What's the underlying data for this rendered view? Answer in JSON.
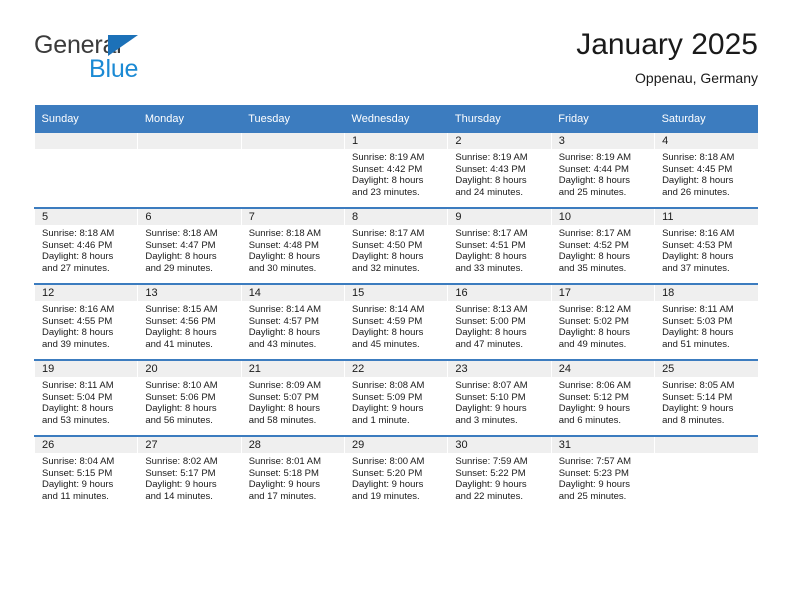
{
  "brand": {
    "name_line1": "General",
    "name_line2": "Blue",
    "triangle_color": "#1c71b8",
    "line1_color": "#3b3b3b",
    "line2_color": "#1b8ad4"
  },
  "header": {
    "title": "January 2025",
    "subtitle": "Oppenau, Germany"
  },
  "theme": {
    "header_bg": "#3c7cbf",
    "header_text": "#ffffff",
    "date_band_bg": "#efefef",
    "cell_bg": "#ffffff",
    "text": "#1a1a1a"
  },
  "calendar": {
    "weekday_headers": [
      "Sunday",
      "Monday",
      "Tuesday",
      "Wednesday",
      "Thursday",
      "Friday",
      "Saturday"
    ],
    "weeks": [
      [
        {
          "day": "",
          "empty": true
        },
        {
          "day": "",
          "empty": true
        },
        {
          "day": "",
          "empty": true
        },
        {
          "day": "1",
          "sunrise": "Sunrise: 8:19 AM",
          "sunset": "Sunset: 4:42 PM",
          "daylight1": "Daylight: 8 hours",
          "daylight2": "and 23 minutes."
        },
        {
          "day": "2",
          "sunrise": "Sunrise: 8:19 AM",
          "sunset": "Sunset: 4:43 PM",
          "daylight1": "Daylight: 8 hours",
          "daylight2": "and 24 minutes."
        },
        {
          "day": "3",
          "sunrise": "Sunrise: 8:19 AM",
          "sunset": "Sunset: 4:44 PM",
          "daylight1": "Daylight: 8 hours",
          "daylight2": "and 25 minutes."
        },
        {
          "day": "4",
          "sunrise": "Sunrise: 8:18 AM",
          "sunset": "Sunset: 4:45 PM",
          "daylight1": "Daylight: 8 hours",
          "daylight2": "and 26 minutes."
        }
      ],
      [
        {
          "day": "5",
          "sunrise": "Sunrise: 8:18 AM",
          "sunset": "Sunset: 4:46 PM",
          "daylight1": "Daylight: 8 hours",
          "daylight2": "and 27 minutes."
        },
        {
          "day": "6",
          "sunrise": "Sunrise: 8:18 AM",
          "sunset": "Sunset: 4:47 PM",
          "daylight1": "Daylight: 8 hours",
          "daylight2": "and 29 minutes."
        },
        {
          "day": "7",
          "sunrise": "Sunrise: 8:18 AM",
          "sunset": "Sunset: 4:48 PM",
          "daylight1": "Daylight: 8 hours",
          "daylight2": "and 30 minutes."
        },
        {
          "day": "8",
          "sunrise": "Sunrise: 8:17 AM",
          "sunset": "Sunset: 4:50 PM",
          "daylight1": "Daylight: 8 hours",
          "daylight2": "and 32 minutes."
        },
        {
          "day": "9",
          "sunrise": "Sunrise: 8:17 AM",
          "sunset": "Sunset: 4:51 PM",
          "daylight1": "Daylight: 8 hours",
          "daylight2": "and 33 minutes."
        },
        {
          "day": "10",
          "sunrise": "Sunrise: 8:17 AM",
          "sunset": "Sunset: 4:52 PM",
          "daylight1": "Daylight: 8 hours",
          "daylight2": "and 35 minutes."
        },
        {
          "day": "11",
          "sunrise": "Sunrise: 8:16 AM",
          "sunset": "Sunset: 4:53 PM",
          "daylight1": "Daylight: 8 hours",
          "daylight2": "and 37 minutes."
        }
      ],
      [
        {
          "day": "12",
          "sunrise": "Sunrise: 8:16 AM",
          "sunset": "Sunset: 4:55 PM",
          "daylight1": "Daylight: 8 hours",
          "daylight2": "and 39 minutes."
        },
        {
          "day": "13",
          "sunrise": "Sunrise: 8:15 AM",
          "sunset": "Sunset: 4:56 PM",
          "daylight1": "Daylight: 8 hours",
          "daylight2": "and 41 minutes."
        },
        {
          "day": "14",
          "sunrise": "Sunrise: 8:14 AM",
          "sunset": "Sunset: 4:57 PM",
          "daylight1": "Daylight: 8 hours",
          "daylight2": "and 43 minutes."
        },
        {
          "day": "15",
          "sunrise": "Sunrise: 8:14 AM",
          "sunset": "Sunset: 4:59 PM",
          "daylight1": "Daylight: 8 hours",
          "daylight2": "and 45 minutes."
        },
        {
          "day": "16",
          "sunrise": "Sunrise: 8:13 AM",
          "sunset": "Sunset: 5:00 PM",
          "daylight1": "Daylight: 8 hours",
          "daylight2": "and 47 minutes."
        },
        {
          "day": "17",
          "sunrise": "Sunrise: 8:12 AM",
          "sunset": "Sunset: 5:02 PM",
          "daylight1": "Daylight: 8 hours",
          "daylight2": "and 49 minutes."
        },
        {
          "day": "18",
          "sunrise": "Sunrise: 8:11 AM",
          "sunset": "Sunset: 5:03 PM",
          "daylight1": "Daylight: 8 hours",
          "daylight2": "and 51 minutes."
        }
      ],
      [
        {
          "day": "19",
          "sunrise": "Sunrise: 8:11 AM",
          "sunset": "Sunset: 5:04 PM",
          "daylight1": "Daylight: 8 hours",
          "daylight2": "and 53 minutes."
        },
        {
          "day": "20",
          "sunrise": "Sunrise: 8:10 AM",
          "sunset": "Sunset: 5:06 PM",
          "daylight1": "Daylight: 8 hours",
          "daylight2": "and 56 minutes."
        },
        {
          "day": "21",
          "sunrise": "Sunrise: 8:09 AM",
          "sunset": "Sunset: 5:07 PM",
          "daylight1": "Daylight: 8 hours",
          "daylight2": "and 58 minutes."
        },
        {
          "day": "22",
          "sunrise": "Sunrise: 8:08 AM",
          "sunset": "Sunset: 5:09 PM",
          "daylight1": "Daylight: 9 hours",
          "daylight2": "and 1 minute."
        },
        {
          "day": "23",
          "sunrise": "Sunrise: 8:07 AM",
          "sunset": "Sunset: 5:10 PM",
          "daylight1": "Daylight: 9 hours",
          "daylight2": "and 3 minutes."
        },
        {
          "day": "24",
          "sunrise": "Sunrise: 8:06 AM",
          "sunset": "Sunset: 5:12 PM",
          "daylight1": "Daylight: 9 hours",
          "daylight2": "and 6 minutes."
        },
        {
          "day": "25",
          "sunrise": "Sunrise: 8:05 AM",
          "sunset": "Sunset: 5:14 PM",
          "daylight1": "Daylight: 9 hours",
          "daylight2": "and 8 minutes."
        }
      ],
      [
        {
          "day": "26",
          "sunrise": "Sunrise: 8:04 AM",
          "sunset": "Sunset: 5:15 PM",
          "daylight1": "Daylight: 9 hours",
          "daylight2": "and 11 minutes."
        },
        {
          "day": "27",
          "sunrise": "Sunrise: 8:02 AM",
          "sunset": "Sunset: 5:17 PM",
          "daylight1": "Daylight: 9 hours",
          "daylight2": "and 14 minutes."
        },
        {
          "day": "28",
          "sunrise": "Sunrise: 8:01 AM",
          "sunset": "Sunset: 5:18 PM",
          "daylight1": "Daylight: 9 hours",
          "daylight2": "and 17 minutes."
        },
        {
          "day": "29",
          "sunrise": "Sunrise: 8:00 AM",
          "sunset": "Sunset: 5:20 PM",
          "daylight1": "Daylight: 9 hours",
          "daylight2": "and 19 minutes."
        },
        {
          "day": "30",
          "sunrise": "Sunrise: 7:59 AM",
          "sunset": "Sunset: 5:22 PM",
          "daylight1": "Daylight: 9 hours",
          "daylight2": "and 22 minutes."
        },
        {
          "day": "31",
          "sunrise": "Sunrise: 7:57 AM",
          "sunset": "Sunset: 5:23 PM",
          "daylight1": "Daylight: 9 hours",
          "daylight2": "and 25 minutes."
        },
        {
          "day": "",
          "empty": true
        }
      ]
    ]
  }
}
